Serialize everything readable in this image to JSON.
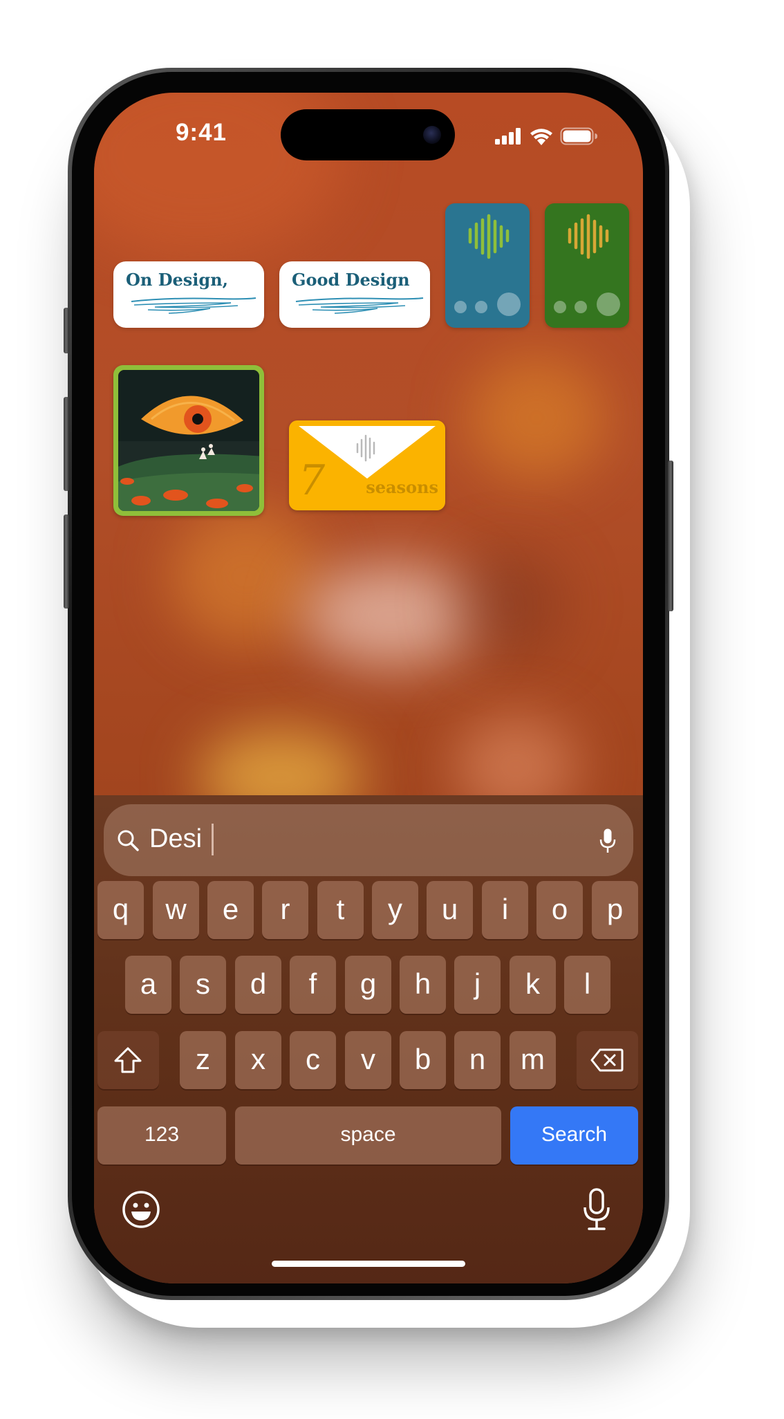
{
  "status_bar": {
    "time": "9:41",
    "icons": [
      "cellular-signal-icon",
      "wifi-icon",
      "battery-icon"
    ]
  },
  "widgets": {
    "book_one": {
      "title": "On Design,"
    },
    "book_two": {
      "title": "Good Design"
    },
    "audio_blue": {
      "color": "#2a7591",
      "accent": "#8fbf3a"
    },
    "audio_green": {
      "color": "#34751f",
      "accent": "#d7a736"
    },
    "artwork": {
      "icon": "eye-artwork-icon"
    },
    "seasons_envelope": {
      "number": "7",
      "word": "seasons"
    }
  },
  "search": {
    "query": "Desi",
    "left_icon": "search-icon",
    "right_icon": "microphone-icon"
  },
  "keyboard": {
    "row1": [
      "q",
      "w",
      "e",
      "r",
      "t",
      "y",
      "u",
      "i",
      "o",
      "p"
    ],
    "row2": [
      "a",
      "s",
      "d",
      "f",
      "g",
      "h",
      "j",
      "k",
      "l"
    ],
    "row3": [
      "z",
      "x",
      "c",
      "v",
      "b",
      "n",
      "m"
    ],
    "shift_icon": "shift-icon",
    "delete_icon": "delete-icon",
    "numbers_label": "123",
    "space_label": "space",
    "search_label": "Search",
    "emoji_icon": "emoji-icon",
    "dictation_icon": "microphone-icon"
  },
  "colors": {
    "accent": "#3478f6",
    "wallpaper": "#b24e28"
  }
}
